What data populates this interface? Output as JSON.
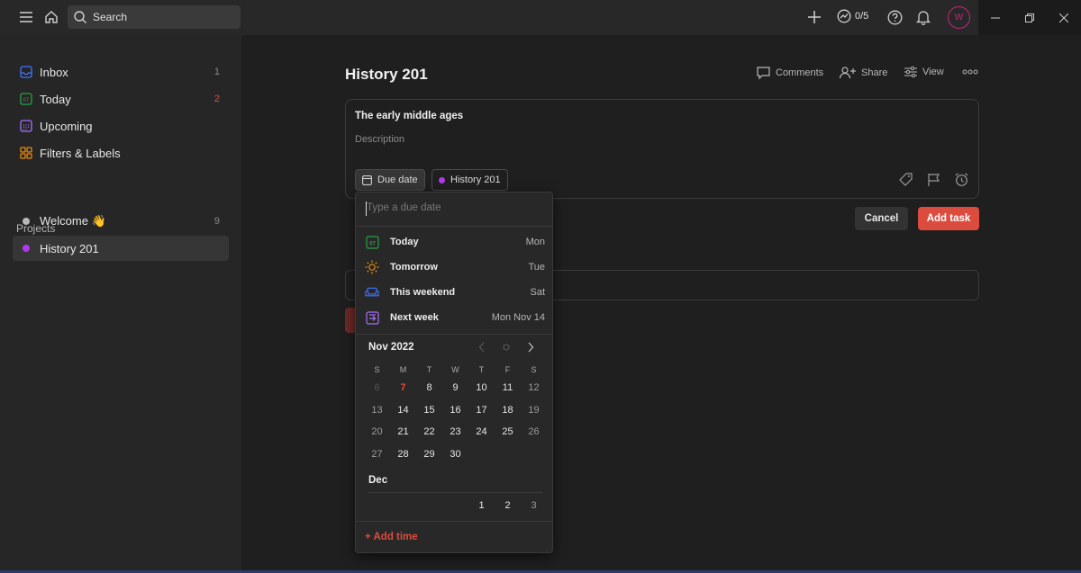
{
  "topbar": {
    "search_label": "Search",
    "karma": "0/5",
    "avatar_initial": "W"
  },
  "sidebar": {
    "items": [
      {
        "label": "Inbox",
        "count": "1"
      },
      {
        "label": "Today",
        "count": "2"
      },
      {
        "label": "Upcoming",
        "count": ""
      },
      {
        "label": "Filters & Labels",
        "count": ""
      }
    ],
    "projects_heading": "Projects",
    "projects": [
      {
        "label": "Welcome 👋",
        "count": "9",
        "color": "#b8b8b8"
      },
      {
        "label": "History 201",
        "count": "",
        "color": "#af38eb"
      }
    ]
  },
  "main": {
    "title": "History 201",
    "actions": {
      "comments": "Comments",
      "share": "Share",
      "view": "View"
    },
    "task": {
      "name": "The early middle ages",
      "description_placeholder": "Description",
      "due_chip": "Due date",
      "project_chip": "History 201"
    },
    "cancel_label": "Cancel",
    "add_task_label": "Add task"
  },
  "due_popup": {
    "input_placeholder": "Type a due date",
    "today_icon_text": "07",
    "suggestions": [
      {
        "label": "Today",
        "day": "Mon",
        "icon": "calendar-today-icon",
        "color": "#25a244"
      },
      {
        "label": "Tomorrow",
        "day": "Tue",
        "icon": "sun-icon",
        "color": "#eb8909"
      },
      {
        "label": "This weekend",
        "day": "Sat",
        "icon": "sofa-icon",
        "color": "#4073ff"
      },
      {
        "label": "Next week",
        "day": "Mon Nov 14",
        "icon": "next-week-icon",
        "color": "#a970ff"
      }
    ],
    "month": "Nov 2022",
    "weekdays": [
      "S",
      "M",
      "T",
      "W",
      "T",
      "F",
      "S"
    ],
    "nov_days": [
      [
        "6",
        "7",
        "8",
        "9",
        "10",
        "11",
        "12"
      ],
      [
        "13",
        "14",
        "15",
        "16",
        "17",
        "18",
        "19"
      ],
      [
        "20",
        "21",
        "22",
        "23",
        "24",
        "25",
        "26"
      ],
      [
        "27",
        "28",
        "29",
        "30",
        "",
        "",
        ""
      ]
    ],
    "next_month": "Dec",
    "dec_days": [
      "",
      "",
      "",
      "",
      "1",
      "2",
      "3"
    ],
    "add_time": "+ Add time"
  },
  "colors": {
    "accent": "#dc4c3e",
    "background": "#1f1f1f",
    "sidebar": "#262626"
  }
}
